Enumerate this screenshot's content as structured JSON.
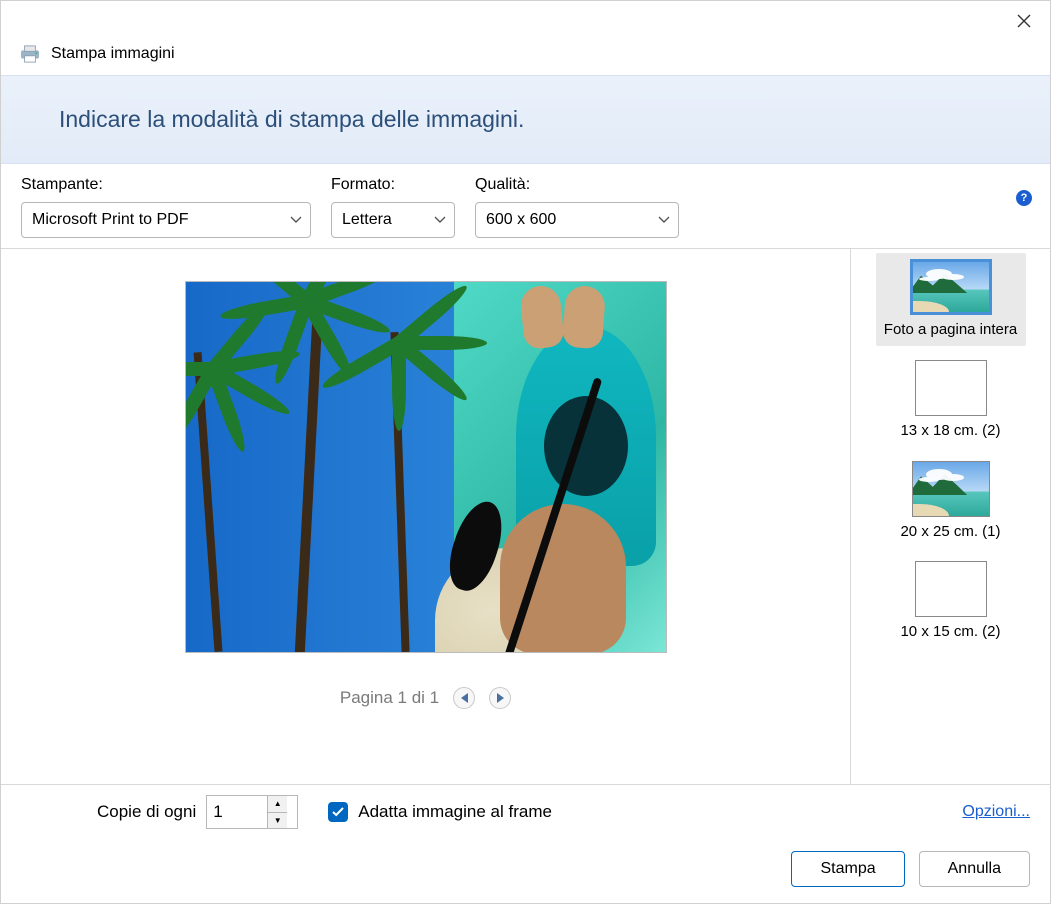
{
  "titlebar": {
    "close_label": "Close"
  },
  "header": {
    "title": "Stampa immagini"
  },
  "banner": {
    "text": "Indicare la modalità di stampa delle immagini."
  },
  "controls": {
    "printer_label": "Stampante:",
    "printer_value": "Microsoft Print to PDF",
    "format_label": "Formato:",
    "format_value": "Lettera",
    "quality_label": "Qualità:",
    "quality_value": "600 x 600",
    "help_label": "?"
  },
  "preview": {
    "pager_text": "Pagina 1 di 1"
  },
  "layouts": [
    {
      "label": "Foto a pagina intera",
      "selected": true,
      "style": "full"
    },
    {
      "label": "13 x 18 cm. (2)",
      "selected": false,
      "style": "pair"
    },
    {
      "label": "20 x 25 cm. (1)",
      "selected": false,
      "style": "single"
    },
    {
      "label": "10 x 15 cm. (2)",
      "selected": false,
      "style": "pair"
    }
  ],
  "bottom": {
    "copies_label": "Copie di ogni",
    "copies_value": "1",
    "fit_checked": true,
    "fit_label": "Adatta immagine al frame",
    "options_link": "Opzioni..."
  },
  "buttons": {
    "print": "Stampa",
    "cancel": "Annulla"
  }
}
